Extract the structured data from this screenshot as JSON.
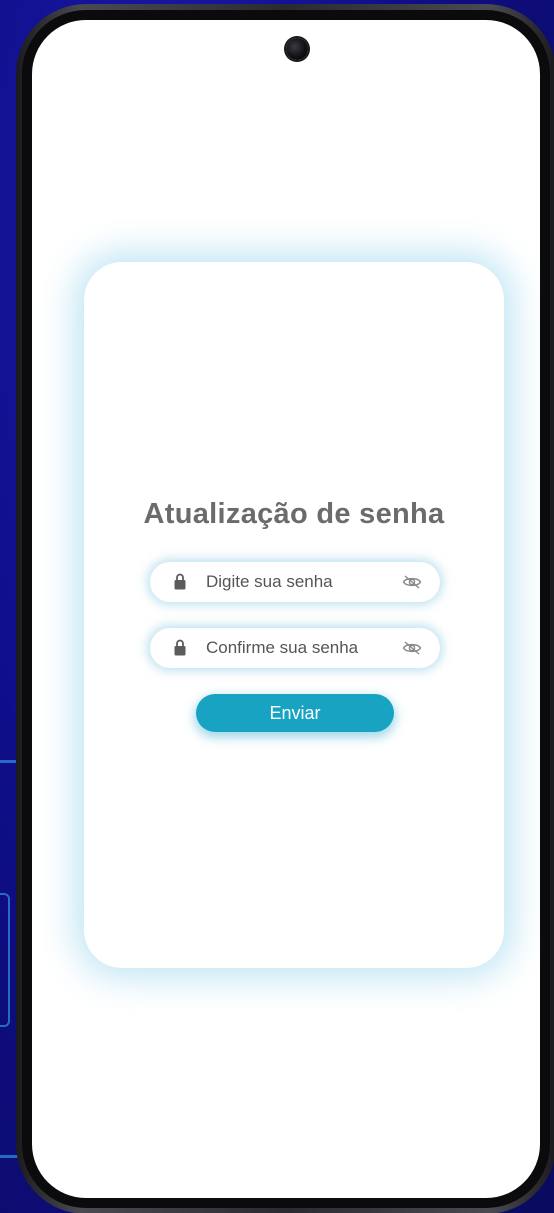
{
  "form": {
    "title": "Atualização de senha",
    "password_field": {
      "placeholder": "Digite sua senha",
      "value": "",
      "leading_icon": "lock-icon",
      "trailing_icon": "eye-slash-icon"
    },
    "confirm_field": {
      "placeholder": "Confirme sua senha",
      "value": "",
      "leading_icon": "lock-icon",
      "trailing_icon": "eye-slash-icon"
    },
    "submit_label": "Enviar"
  },
  "colors": {
    "accent": "#18a3c2",
    "background": "#0f0e8a",
    "card": "#ffffff",
    "title_text": "#6b6b6b"
  }
}
